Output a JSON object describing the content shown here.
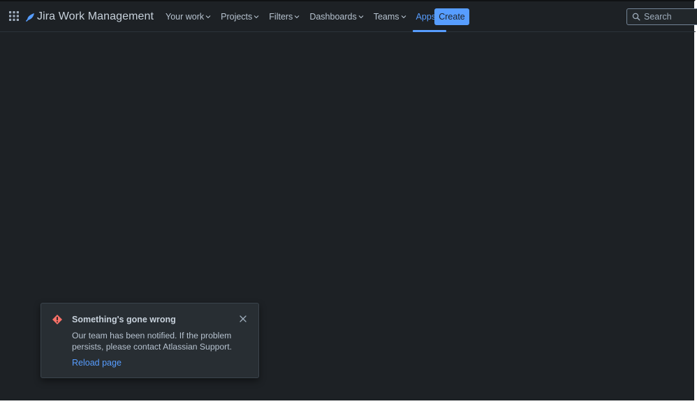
{
  "header": {
    "app_name": "Jira Work Management",
    "nav": [
      {
        "label": "Your work"
      },
      {
        "label": "Projects"
      },
      {
        "label": "Filters"
      },
      {
        "label": "Dashboards"
      },
      {
        "label": "Teams"
      },
      {
        "label": "Apps",
        "active": true
      }
    ],
    "create_label": "Create",
    "search_placeholder": "Search"
  },
  "flag": {
    "title": "Something's gone wrong",
    "body": "Our team has been notified. If the problem persists, please contact Atlassian Support.",
    "action_label": "Reload page",
    "icon": "error-icon"
  },
  "colors": {
    "background": "#1d2125",
    "accent": "#579dff",
    "error": "#f87168"
  }
}
